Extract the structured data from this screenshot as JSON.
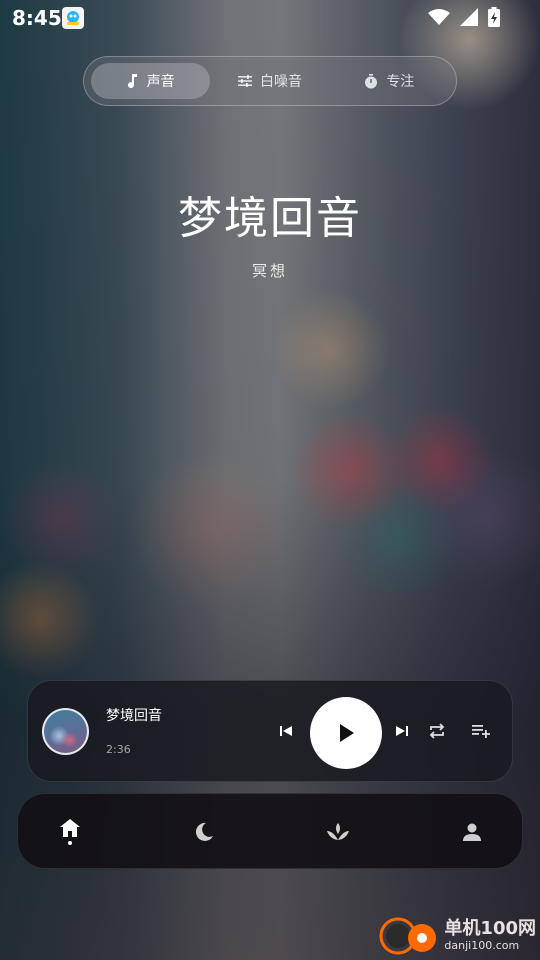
{
  "status_bar": {
    "time": "8:45",
    "app_icon": "app-notification-icon",
    "icons": [
      "wifi-icon",
      "signal-icon",
      "battery-charging-icon"
    ]
  },
  "tabs": [
    {
      "label": "声音",
      "icon": "music-note-icon",
      "active": true
    },
    {
      "label": "白噪音",
      "icon": "equalizer-icon",
      "active": false
    },
    {
      "label": "专注",
      "icon": "timer-icon",
      "active": false
    }
  ],
  "track": {
    "title": "梦境回音",
    "subtitle": "冥想"
  },
  "player": {
    "title": "梦境回音",
    "time": "2:36",
    "controls": [
      "skip-previous-icon",
      "play-icon",
      "skip-next-icon",
      "repeat-icon",
      "playlist-add-icon"
    ]
  },
  "nav": {
    "items": [
      "home-icon",
      "moon-icon",
      "lotus-icon",
      "person-icon"
    ],
    "active": "home-icon"
  },
  "watermark": {
    "brand": "单机100网",
    "url": "danji100.com"
  },
  "colors": {
    "accent": "#ffffff",
    "watermark_orange": "#ff6a00"
  }
}
